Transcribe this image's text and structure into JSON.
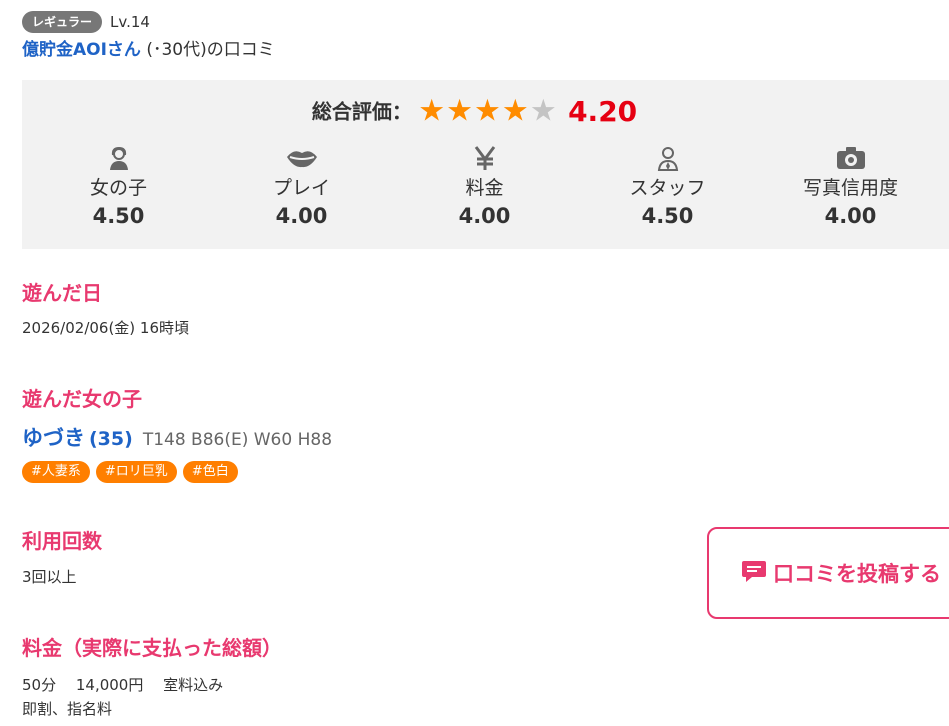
{
  "reviewer": {
    "badge": "レギュラー",
    "level": "Lv.14",
    "name": "億貯金AOIさん",
    "meta": "(･30代)の口コミ"
  },
  "rating": {
    "overall_label": "総合評価：",
    "stars_filled": 4,
    "stars_total": 5,
    "overall_score": "4.20",
    "categories": [
      {
        "name": "女の子",
        "score": "4.50",
        "icon": "girl-person-icon"
      },
      {
        "name": "プレイ",
        "score": "4.00",
        "icon": "lips-icon"
      },
      {
        "name": "料金",
        "score": "4.00",
        "icon": "yen-icon"
      },
      {
        "name": "スタッフ",
        "score": "4.50",
        "icon": "staff-person-icon"
      },
      {
        "name": "写真信用度",
        "score": "4.00",
        "icon": "camera-icon"
      }
    ]
  },
  "visit_date": {
    "heading": "遊んだ日",
    "value": "2026/02/06(金) 16時頃"
  },
  "girl": {
    "heading": "遊んだ女の子",
    "name": "ゆづき",
    "age": "(35)",
    "stats": "T148 B86(E) W60 H88",
    "tags": [
      "#人妻系",
      "#ロリ巨乳",
      "#色白"
    ]
  },
  "usage": {
    "heading": "利用回数",
    "value": "3回以上"
  },
  "price": {
    "heading": "料金（実際に支払った総額）",
    "line1": "50分　 14,000円　 室料込み",
    "line2": "即割、指名料"
  },
  "post_button": {
    "label": "口コミを投稿する",
    "icon": "speech-bubble-icon"
  },
  "colors": {
    "accent_pink": "#e8396f",
    "link_blue": "#1f63c6",
    "star_orange": "#ff8c00",
    "score_red": "#e60012",
    "tag_orange": "#ff7f00"
  }
}
